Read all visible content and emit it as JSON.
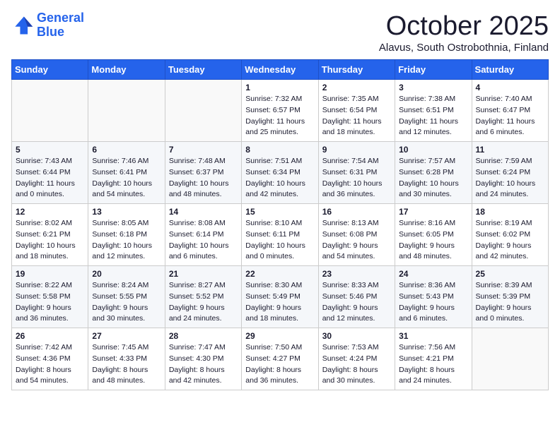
{
  "header": {
    "logo_line1": "General",
    "logo_line2": "Blue",
    "month": "October 2025",
    "location": "Alavus, South Ostrobothnia, Finland"
  },
  "weekdays": [
    "Sunday",
    "Monday",
    "Tuesday",
    "Wednesday",
    "Thursday",
    "Friday",
    "Saturday"
  ],
  "weeks": [
    [
      {
        "day": "",
        "info": ""
      },
      {
        "day": "",
        "info": ""
      },
      {
        "day": "",
        "info": ""
      },
      {
        "day": "1",
        "info": "Sunrise: 7:32 AM\nSunset: 6:57 PM\nDaylight: 11 hours\nand 25 minutes."
      },
      {
        "day": "2",
        "info": "Sunrise: 7:35 AM\nSunset: 6:54 PM\nDaylight: 11 hours\nand 18 minutes."
      },
      {
        "day": "3",
        "info": "Sunrise: 7:38 AM\nSunset: 6:51 PM\nDaylight: 11 hours\nand 12 minutes."
      },
      {
        "day": "4",
        "info": "Sunrise: 7:40 AM\nSunset: 6:47 PM\nDaylight: 11 hours\nand 6 minutes."
      }
    ],
    [
      {
        "day": "5",
        "info": "Sunrise: 7:43 AM\nSunset: 6:44 PM\nDaylight: 11 hours\nand 0 minutes."
      },
      {
        "day": "6",
        "info": "Sunrise: 7:46 AM\nSunset: 6:41 PM\nDaylight: 10 hours\nand 54 minutes."
      },
      {
        "day": "7",
        "info": "Sunrise: 7:48 AM\nSunset: 6:37 PM\nDaylight: 10 hours\nand 48 minutes."
      },
      {
        "day": "8",
        "info": "Sunrise: 7:51 AM\nSunset: 6:34 PM\nDaylight: 10 hours\nand 42 minutes."
      },
      {
        "day": "9",
        "info": "Sunrise: 7:54 AM\nSunset: 6:31 PM\nDaylight: 10 hours\nand 36 minutes."
      },
      {
        "day": "10",
        "info": "Sunrise: 7:57 AM\nSunset: 6:28 PM\nDaylight: 10 hours\nand 30 minutes."
      },
      {
        "day": "11",
        "info": "Sunrise: 7:59 AM\nSunset: 6:24 PM\nDaylight: 10 hours\nand 24 minutes."
      }
    ],
    [
      {
        "day": "12",
        "info": "Sunrise: 8:02 AM\nSunset: 6:21 PM\nDaylight: 10 hours\nand 18 minutes."
      },
      {
        "day": "13",
        "info": "Sunrise: 8:05 AM\nSunset: 6:18 PM\nDaylight: 10 hours\nand 12 minutes."
      },
      {
        "day": "14",
        "info": "Sunrise: 8:08 AM\nSunset: 6:14 PM\nDaylight: 10 hours\nand 6 minutes."
      },
      {
        "day": "15",
        "info": "Sunrise: 8:10 AM\nSunset: 6:11 PM\nDaylight: 10 hours\nand 0 minutes."
      },
      {
        "day": "16",
        "info": "Sunrise: 8:13 AM\nSunset: 6:08 PM\nDaylight: 9 hours\nand 54 minutes."
      },
      {
        "day": "17",
        "info": "Sunrise: 8:16 AM\nSunset: 6:05 PM\nDaylight: 9 hours\nand 48 minutes."
      },
      {
        "day": "18",
        "info": "Sunrise: 8:19 AM\nSunset: 6:02 PM\nDaylight: 9 hours\nand 42 minutes."
      }
    ],
    [
      {
        "day": "19",
        "info": "Sunrise: 8:22 AM\nSunset: 5:58 PM\nDaylight: 9 hours\nand 36 minutes."
      },
      {
        "day": "20",
        "info": "Sunrise: 8:24 AM\nSunset: 5:55 PM\nDaylight: 9 hours\nand 30 minutes."
      },
      {
        "day": "21",
        "info": "Sunrise: 8:27 AM\nSunset: 5:52 PM\nDaylight: 9 hours\nand 24 minutes."
      },
      {
        "day": "22",
        "info": "Sunrise: 8:30 AM\nSunset: 5:49 PM\nDaylight: 9 hours\nand 18 minutes."
      },
      {
        "day": "23",
        "info": "Sunrise: 8:33 AM\nSunset: 5:46 PM\nDaylight: 9 hours\nand 12 minutes."
      },
      {
        "day": "24",
        "info": "Sunrise: 8:36 AM\nSunset: 5:43 PM\nDaylight: 9 hours\nand 6 minutes."
      },
      {
        "day": "25",
        "info": "Sunrise: 8:39 AM\nSunset: 5:39 PM\nDaylight: 9 hours\nand 0 minutes."
      }
    ],
    [
      {
        "day": "26",
        "info": "Sunrise: 7:42 AM\nSunset: 4:36 PM\nDaylight: 8 hours\nand 54 minutes."
      },
      {
        "day": "27",
        "info": "Sunrise: 7:45 AM\nSunset: 4:33 PM\nDaylight: 8 hours\nand 48 minutes."
      },
      {
        "day": "28",
        "info": "Sunrise: 7:47 AM\nSunset: 4:30 PM\nDaylight: 8 hours\nand 42 minutes."
      },
      {
        "day": "29",
        "info": "Sunrise: 7:50 AM\nSunset: 4:27 PM\nDaylight: 8 hours\nand 36 minutes."
      },
      {
        "day": "30",
        "info": "Sunrise: 7:53 AM\nSunset: 4:24 PM\nDaylight: 8 hours\nand 30 minutes."
      },
      {
        "day": "31",
        "info": "Sunrise: 7:56 AM\nSunset: 4:21 PM\nDaylight: 8 hours\nand 24 minutes."
      },
      {
        "day": "",
        "info": ""
      }
    ]
  ]
}
